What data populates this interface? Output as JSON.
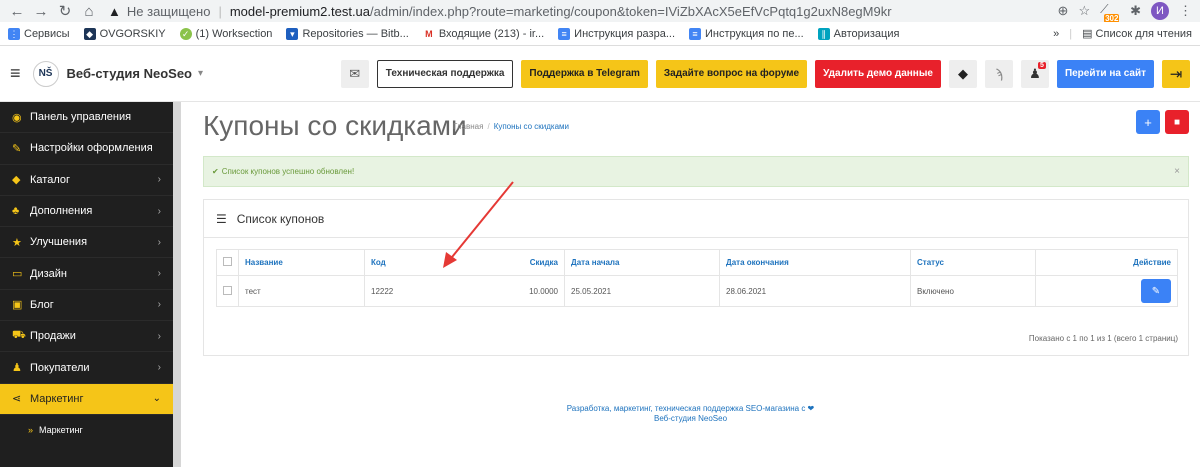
{
  "browser": {
    "insecure_label": "Не защищено",
    "url_host": "model-premium2.test.ua",
    "url_path": "/admin/index.php?route=marketing/coupon&token=IViZbXAcX5eEfVcPqtq1g2uxN8egM9kr",
    "ext_badge": "302",
    "avatar": "И"
  },
  "bookmarks": {
    "items": [
      {
        "label": "Сервисы"
      },
      {
        "label": "OVGORSKIY"
      },
      {
        "label": "(1) Worksection"
      },
      {
        "label": "Repositories — Bitb..."
      },
      {
        "label": "Входящие (213) - ir..."
      },
      {
        "label": "Инструкция разра..."
      },
      {
        "label": "Инструкция по пе..."
      },
      {
        "label": "Авторизация"
      }
    ],
    "more": "»",
    "reading_list": "Список для чтения"
  },
  "topbar": {
    "logo": "NŠ",
    "brand": "Веб-студия NeoSeo",
    "support": "Техническая поддержка",
    "telegram": "Поддержка в Telegram",
    "forum": "Задайте вопрос на форуме",
    "delete_demo": "Удалить демо данные",
    "goto_site": "Перейти на сайт",
    "notif_badge": "5"
  },
  "sidebar": {
    "items": [
      {
        "label": "Панель управления",
        "icon": "◉"
      },
      {
        "label": "Настройки оформления",
        "icon": "✎"
      },
      {
        "label": "Каталог",
        "icon": "◆",
        "chevron": "›"
      },
      {
        "label": "Дополнения",
        "icon": "♣",
        "chevron": "›"
      },
      {
        "label": "Улучшения",
        "icon": "★",
        "chevron": "›"
      },
      {
        "label": "Дизайн",
        "icon": "▭",
        "chevron": "›"
      },
      {
        "label": "Блог",
        "icon": "▣",
        "chevron": "›"
      },
      {
        "label": "Продажи",
        "icon": "⛟",
        "chevron": "›"
      },
      {
        "label": "Покупатели",
        "icon": "♟",
        "chevron": "›"
      },
      {
        "label": "Маркетинг",
        "icon": "⋖",
        "chevron": "⌄"
      }
    ],
    "sub_item": "Маркетинг"
  },
  "main": {
    "title": "Купоны со скидками",
    "breadcrumb_home": "Главная",
    "breadcrumb_current": "Купоны со скидками",
    "alert": "Список купонов успешно обновлен!",
    "panel_title": "Список купонов",
    "columns": {
      "name": "Название",
      "code": "Код",
      "discount": "Скидка",
      "date_start": "Дата начала",
      "date_end": "Дата окончания",
      "status": "Статус",
      "action": "Действие"
    },
    "rows": [
      {
        "name": "тест",
        "code": "12222",
        "discount": "10.0000",
        "date_start": "25.05.2021",
        "date_end": "28.06.2021",
        "status": "Включено"
      }
    ],
    "pagination": "Показано с 1 по 1 из 1 (всего 1 страниц)",
    "footer_line1": "Разработка, маркетинг, техническая поддержка SEO-магазина с ❤",
    "footer_line2": "Веб-студия NeoSeo"
  },
  "colors": {
    "sidebar_bg": "#1f1f1f",
    "accent_yellow": "#f5c518",
    "link_blue": "#1e73be",
    "delete_red": "#e8212b",
    "edit_blue": "#3b82f6",
    "arrow_red": "#e53935"
  }
}
